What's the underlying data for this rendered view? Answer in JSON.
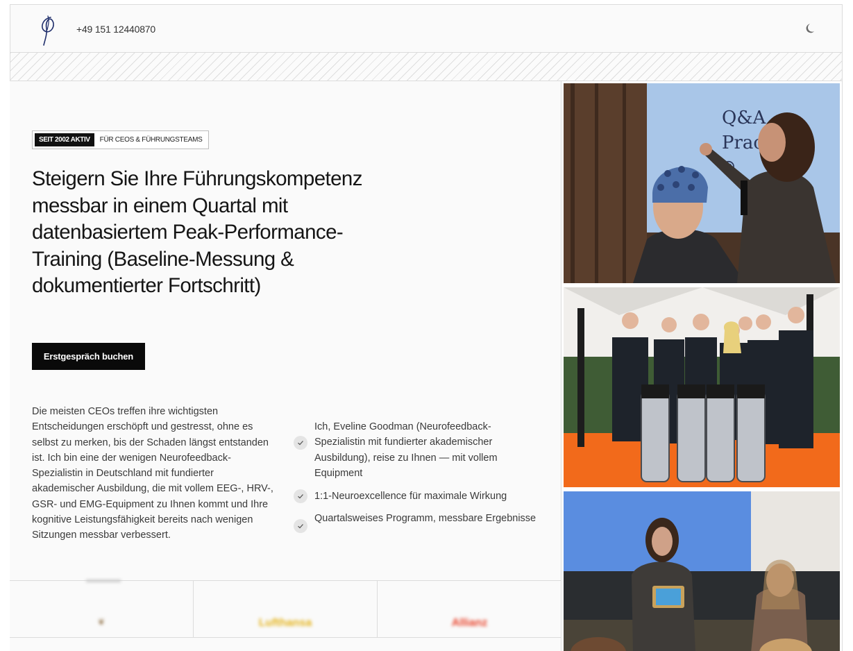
{
  "header": {
    "phone": "+49 151 12440870"
  },
  "hero": {
    "badge_primary": "SEIT 2002 AKTIV",
    "badge_secondary": "FÜR CEOS & FÜHRUNGSTEAMS",
    "headline": "Steigern Sie Ihre Führungskompetenz messbar in einem Quartal mit datenbasiertem Peak-Performance-Training (Baseline-Messung & dokumentierter Fortschritt)",
    "cta_label": "Erstgespräch buchen",
    "intro": "Die meisten CEOs treffen ihre wichtigsten Entscheidungen erschöpft und gestresst, ohne es selbst zu merken, bis der Schaden längst entstanden ist. Ich bin eine der wenigen Neurofeedback-Spezialistin in Deutschland mit fundierter akademischer Ausbildung, die mit vollem EEG-, HRV-, GSR- und EMG-Equipment zu Ihnen kommt und Ihre kognitive Leistungsfähigkeit bereits nach wenigen Sitzungen messbar verbessert.",
    "checklist": [
      "Ich, Eveline Goodman (Neurofeedback-Spezialistin mit fundierter akademischer Ausbildung), reise zu Ihnen — mit vollem Equipment",
      "1:1-Neuroexcellence für maximale Wirkung",
      "Quartalsweises Programm, messbare Ergebnisse"
    ]
  },
  "logos": [
    "Lufthansa",
    "Allianz"
  ],
  "photos": {
    "photo_1_screen_text": [
      "Q&A",
      "Pract",
      "☺"
    ]
  },
  "icons": {
    "logo": "signature-logo-icon",
    "theme": "moon-icon",
    "check": "check-icon"
  },
  "colors": {
    "accent_dark": "#0a0a0a",
    "logo_blue": "#1f2e6b",
    "check_bg": "#e4e4e4"
  }
}
